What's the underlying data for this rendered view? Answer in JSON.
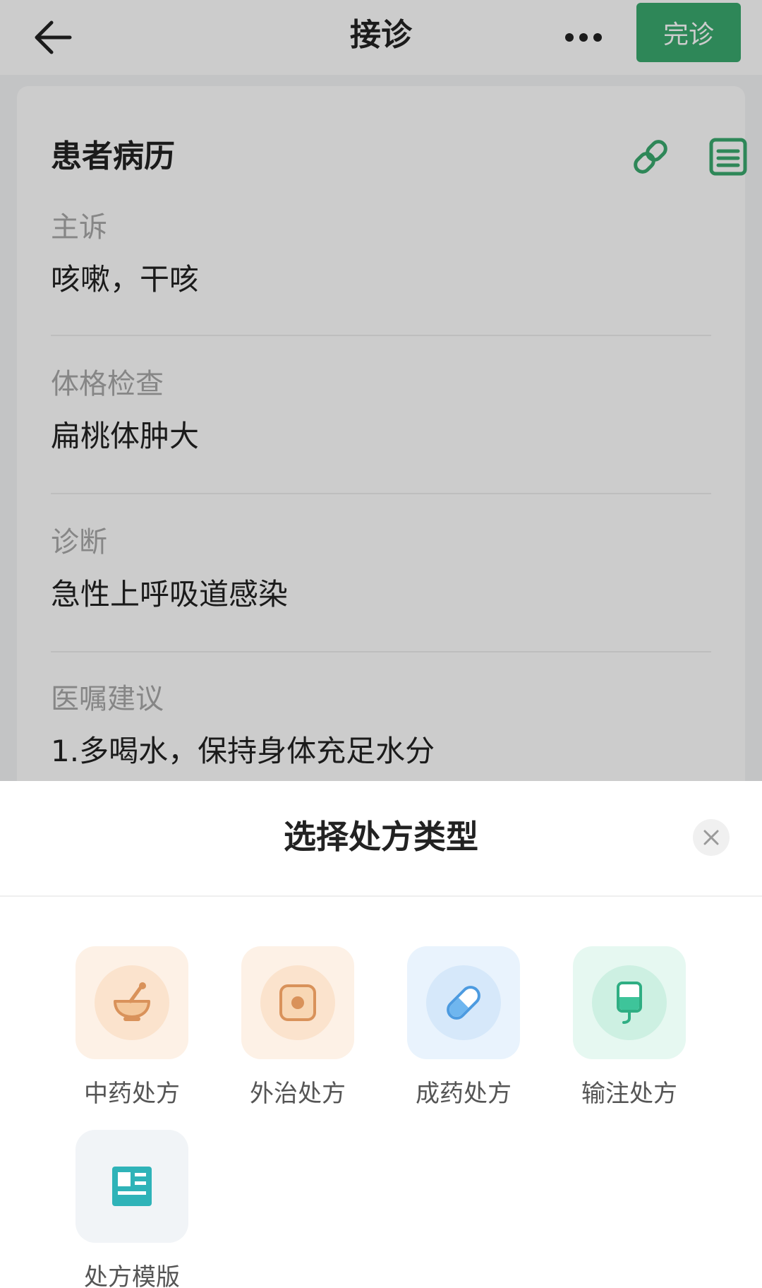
{
  "nav": {
    "title": "接诊",
    "finish_label": "完诊"
  },
  "record": {
    "title": "患者病历",
    "sections": [
      {
        "label": "主诉",
        "value": "咳嗽，干咳"
      },
      {
        "label": "体格检查",
        "value": "扁桃体肿大"
      },
      {
        "label": "诊断",
        "value": "急性上呼吸道感染"
      },
      {
        "label": "医嘱建议",
        "value": "1.多喝水，保持身体充足水分"
      }
    ]
  },
  "sheet": {
    "title": "选择处方类型",
    "options": [
      {
        "label": "中药处方",
        "icon": "mortar-icon"
      },
      {
        "label": "外治处方",
        "icon": "plaster-icon"
      },
      {
        "label": "成药处方",
        "icon": "pill-icon"
      },
      {
        "label": "输注处方",
        "icon": "iv-bag-icon"
      },
      {
        "label": "处方模版",
        "icon": "template-icon"
      }
    ]
  },
  "colors": {
    "accent_green": "#3aa96e",
    "tcm_orange": "#e8a064",
    "pill_blue": "#6fb6ef",
    "iv_green": "#3ec49a",
    "template_teal": "#2fb3b8"
  }
}
